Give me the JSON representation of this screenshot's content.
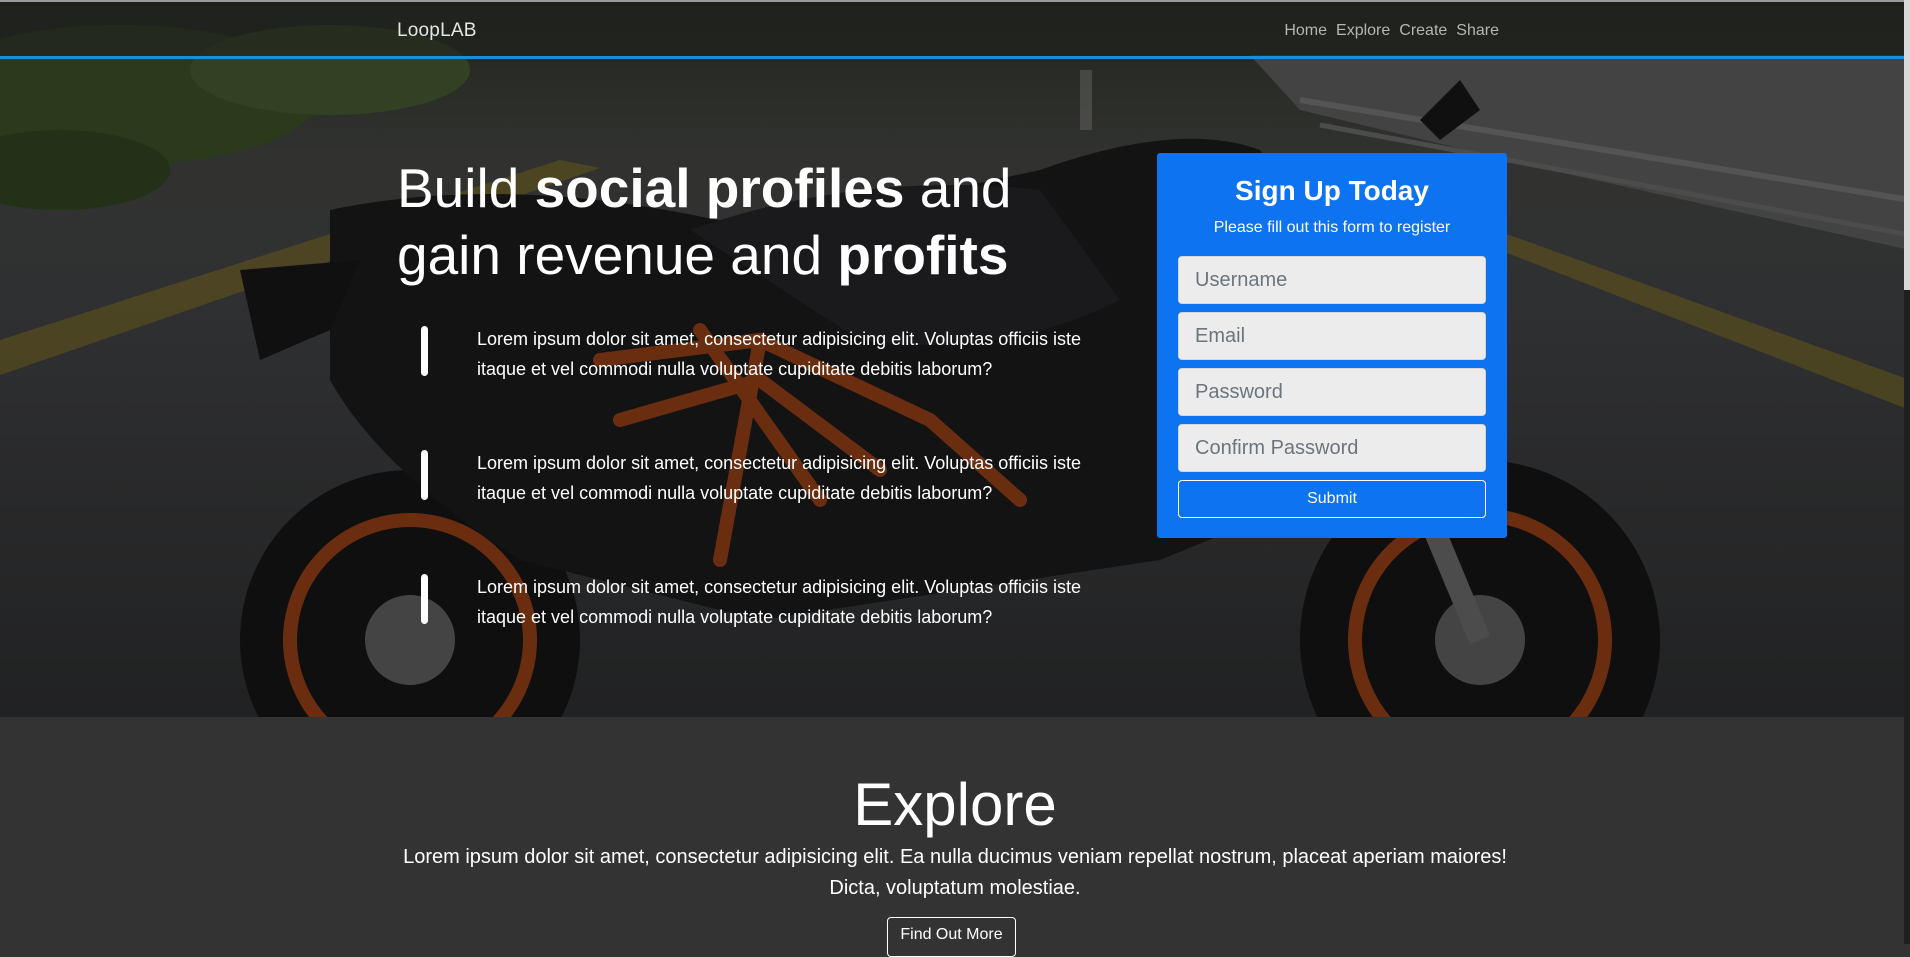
{
  "navbar": {
    "brand": "LoopLAB",
    "links": [
      "Home",
      "Explore",
      "Create",
      "Share"
    ]
  },
  "hero": {
    "headline": {
      "part1": "Build ",
      "bold1": "social profiles",
      "part2": " and gain revenue and ",
      "bold2": "profits"
    },
    "features": [
      "Lorem ipsum dolor sit amet, consectetur adipisicing elit. Voluptas officiis iste itaque et vel commodi nulla voluptate cupiditate debitis laborum?",
      "Lorem ipsum dolor sit amet, consectetur adipisicing elit. Voluptas officiis iste itaque et vel commodi nulla voluptate cupiditate debitis laborum?",
      "Lorem ipsum dolor sit amet, consectetur adipisicing elit. Voluptas officiis iste itaque et vel commodi nulla voluptate cupiditate debitis laborum?"
    ]
  },
  "signup": {
    "title": "Sign Up Today",
    "subtitle": "Please fill out this form to register",
    "username_placeholder": "Username",
    "email_placeholder": "Email",
    "password_placeholder": "Password",
    "confirm_placeholder": "Confirm Password",
    "submit_label": "Submit"
  },
  "explore": {
    "title": "Explore",
    "body": "Lorem ipsum dolor sit amet, consectetur adipisicing elit. Ea nulla ducimus veniam repellat nostrum, placeat aperiam maiores! Dicta, voluptatum molestiae.",
    "button_label": "Find Out More"
  },
  "colors": {
    "accent_border": "#1a8fd6",
    "card_bg": "#0d73f0",
    "page_bg": "#333333"
  }
}
